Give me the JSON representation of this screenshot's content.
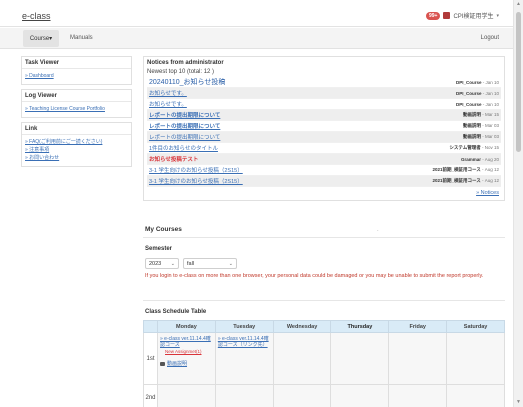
{
  "header": {
    "brand": "e-class",
    "badge": "99+",
    "user_name": "CPI検証用学生",
    "chevron": "▾"
  },
  "nav": {
    "course": "Course▾",
    "manuals": "Manuals",
    "logout": "Logout"
  },
  "sidebar": {
    "task_viewer": {
      "title": "Task Viewer",
      "items": [
        "» Dashboard"
      ]
    },
    "log_viewer": {
      "title": "Log Viewer",
      "items": [
        "» Teaching License Course Portfolio"
      ]
    },
    "link": {
      "title": "Link",
      "items": [
        "» FAQ(ご利用前にご一読ください)",
        "» 注意事項",
        "» お問い合わせ"
      ]
    }
  },
  "notices": {
    "title": "Notices from administrator",
    "subtitle": "Newest top 10 (total: 12 )",
    "rows": [
      {
        "title": "20240110_お知らせ投稿",
        "author": "DPI_Course",
        "date": " - Jan 10"
      },
      {
        "title": "お知らせです。",
        "author": "DPI_Course",
        "date": " - Jan 10"
      },
      {
        "title": "お知らせです。",
        "author": "DPI_Course",
        "date": " - Jan 10"
      },
      {
        "title": "レポートの提出期限について",
        "author": "動画説明",
        "date": " - Mar 15"
      },
      {
        "title": "レポートの提出期限について",
        "author": "動画説明",
        "date": " - Mar 03"
      },
      {
        "title": "レポートの提出期限について",
        "author": "動画説明",
        "date": " - Mar 03"
      },
      {
        "title": "1件目のお知らせのタイトル",
        "author": "システム管理者",
        "date": " - Nov 15"
      },
      {
        "title": "お知らせ投稿テスト",
        "author": "Grammar",
        "date": " - Aug 20"
      },
      {
        "title": "3-1 学生向けのお知らせ投稿（2S15）",
        "author": "2021前期_検証用コース",
        "date": " - Aug 12"
      },
      {
        "title": "3-1 学生向けのお知らせ投稿（2S15）",
        "author": "2021前期_検証用コース",
        "date": " - Aug 12"
      }
    ],
    "more": "» Notices"
  },
  "my_courses": {
    "title": "My Courses",
    "dot": "."
  },
  "semester": {
    "title": "Semester",
    "year": "2023",
    "term": "fall",
    "warning": "If you login to e-class on more than one browser, your personal data could be damaged or you may be unable to submit the report properly."
  },
  "schedule": {
    "title": "Class Schedule Table",
    "days": [
      "Monday",
      "Tuesday",
      "Wednesday",
      "Thursday",
      "Friday",
      "Saturday"
    ],
    "periods": [
      "1st",
      "2nd"
    ],
    "mon1": {
      "course": "» e-class ver.11.14.4確認コース",
      "new_label": "New Assignmet(1)",
      "video": "動画説明"
    },
    "tue1": {
      "course": "» e-class ver.11.14.4確認コース（リンク先）"
    }
  },
  "colors": {
    "link": "#3a6fb5",
    "warning": "#c0392b",
    "header_row": "#d9ebf7",
    "badge": "#d9534f"
  },
  "icons": {
    "video": "video-icon",
    "user": "user-avatar-icon",
    "select_chevron": "chevron-down-icon"
  }
}
